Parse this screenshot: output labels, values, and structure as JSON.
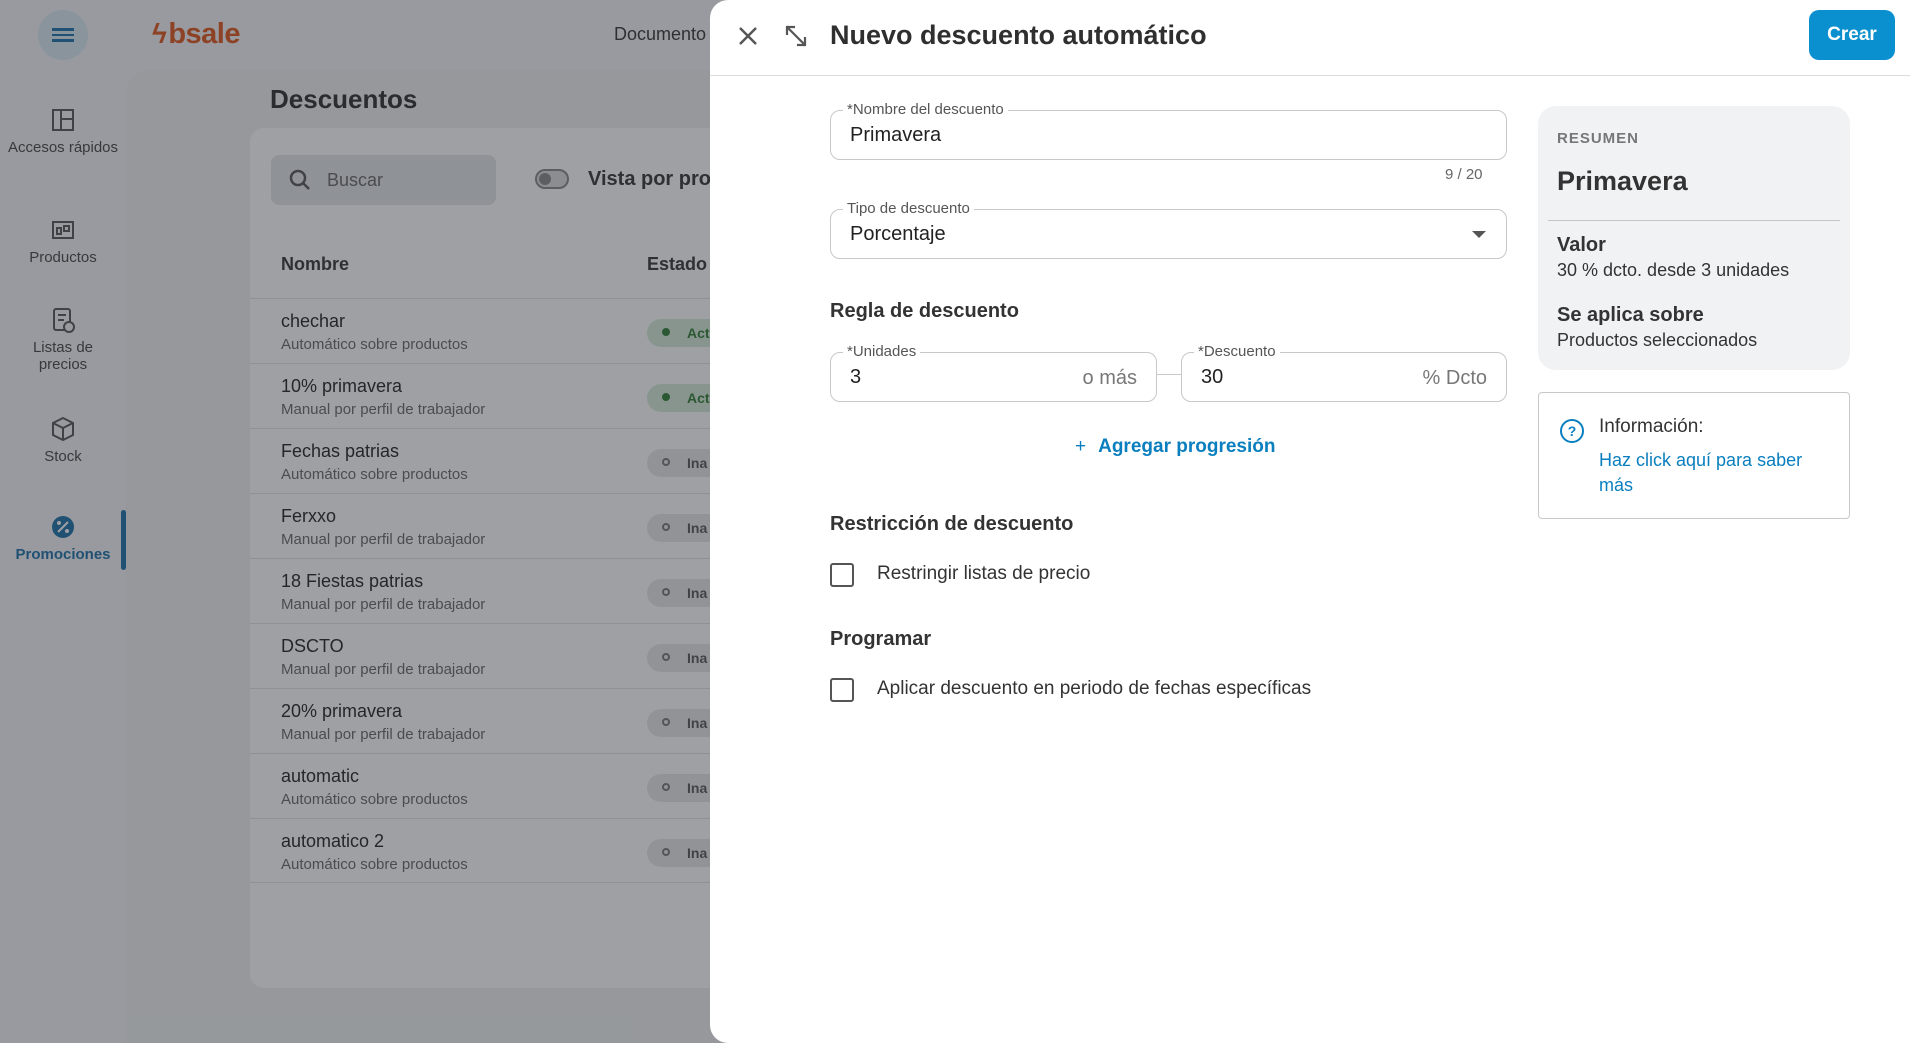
{
  "app": {
    "logo": "bsale",
    "topnav_item": "Documento"
  },
  "sidebar": {
    "items": [
      {
        "label": "Accesos rápidos",
        "icon": "quick-access-icon"
      },
      {
        "label": "Productos",
        "icon": "products-icon"
      },
      {
        "label": "Listas de precios",
        "icon": "price-list-icon"
      },
      {
        "label": "Stock",
        "icon": "stock-box-icon"
      },
      {
        "label": "Promociones",
        "icon": "promotions-icon",
        "active": true
      }
    ]
  },
  "page": {
    "title": "Descuentos",
    "search_placeholder": "Buscar",
    "toggle_label": "Vista por pro",
    "columns": [
      "Nombre",
      "Estado"
    ],
    "rows": [
      {
        "name": "chechar",
        "type": "Automático sobre productos",
        "status": "Act",
        "active": true
      },
      {
        "name": "10% primavera",
        "type": "Manual por perfil de trabajador",
        "status": "Act",
        "active": true
      },
      {
        "name": "Fechas patrias",
        "type": "Automático sobre productos",
        "status": "Ina",
        "active": false
      },
      {
        "name": "Ferxxo",
        "type": "Manual por perfil de trabajador",
        "status": "Ina",
        "active": false
      },
      {
        "name": "18 Fiestas patrias",
        "type": "Manual por perfil de trabajador",
        "status": "Ina",
        "active": false
      },
      {
        "name": "DSCTO",
        "type": "Manual por perfil de trabajador",
        "status": "Ina",
        "active": false
      },
      {
        "name": "20% primavera",
        "type": "Manual por perfil de trabajador",
        "status": "Ina",
        "active": false
      },
      {
        "name": "automatic",
        "type": "Automático sobre productos",
        "status": "Ina",
        "active": false
      },
      {
        "name": "automatico 2",
        "type": "Automático sobre productos",
        "status": "Ina",
        "active": false
      }
    ]
  },
  "drawer": {
    "title": "Nuevo descuento automático",
    "create_label": "Crear",
    "name_field": {
      "label": "*Nombre del descuento",
      "value": "Primavera",
      "counter": "9 / 20"
    },
    "type_field": {
      "label": "Tipo de descuento",
      "value": "Porcentaje"
    },
    "rule_section": "Regla de descuento",
    "units_field": {
      "label": "*Unidades",
      "value": "3",
      "suffix": "o más"
    },
    "discount_field": {
      "label": "*Descuento",
      "value": "30",
      "suffix": "% Dcto"
    },
    "add_progression": "Agregar progresión",
    "restriction_section": "Restricción de descuento",
    "restrict_price_lists": "Restringir listas de precio",
    "schedule_section": "Programar",
    "schedule_dates": "Aplicar descuento en periodo de fechas específicas"
  },
  "summary": {
    "caption": "RESUMEN",
    "name": "Primavera",
    "value_label": "Valor",
    "value_text": "30 % dcto. desde 3 unidades",
    "applies_label": "Se aplica sobre",
    "applies_text": "Productos seleccionados"
  },
  "info": {
    "title": "Información:",
    "link": "Haz click aquí para saber más"
  },
  "colors": {
    "accent": "#0a8fcf",
    "brand": "#e0541b",
    "active_status": "#2e7d32"
  }
}
